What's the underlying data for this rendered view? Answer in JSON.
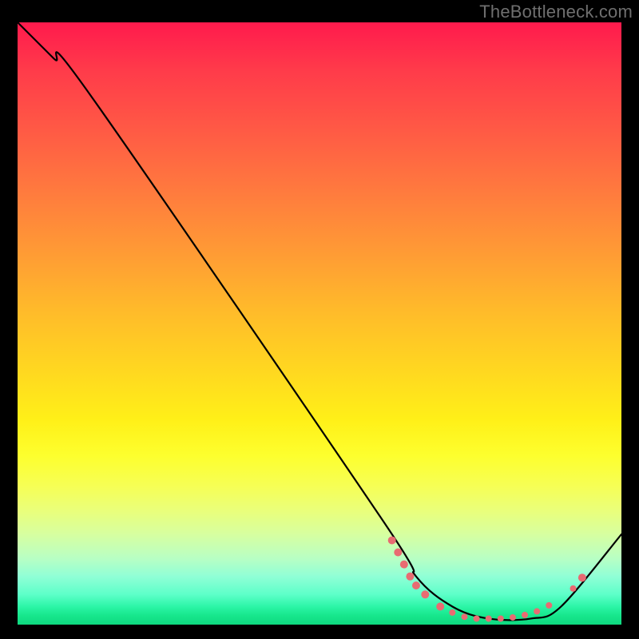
{
  "watermark": "TheBottleneck.com",
  "chart_data": {
    "type": "line",
    "title": "",
    "xlabel": "",
    "ylabel": "",
    "xlim": [
      0,
      100
    ],
    "ylim": [
      0,
      100
    ],
    "series": [
      {
        "name": "curve",
        "points": [
          {
            "x": 0,
            "y": 100
          },
          {
            "x": 6,
            "y": 94
          },
          {
            "x": 12,
            "y": 88
          },
          {
            "x": 60,
            "y": 18
          },
          {
            "x": 66,
            "y": 8
          },
          {
            "x": 72,
            "y": 3
          },
          {
            "x": 78,
            "y": 1
          },
          {
            "x": 85,
            "y": 1
          },
          {
            "x": 90,
            "y": 3
          },
          {
            "x": 100,
            "y": 15
          }
        ]
      }
    ],
    "markers": [
      {
        "x": 62,
        "y": 14,
        "r": 5
      },
      {
        "x": 63,
        "y": 12,
        "r": 5
      },
      {
        "x": 64,
        "y": 10,
        "r": 5
      },
      {
        "x": 65,
        "y": 8,
        "r": 5
      },
      {
        "x": 66,
        "y": 6.5,
        "r": 5
      },
      {
        "x": 67.5,
        "y": 5,
        "r": 5
      },
      {
        "x": 70,
        "y": 3,
        "r": 5
      },
      {
        "x": 72,
        "y": 2,
        "r": 4
      },
      {
        "x": 74,
        "y": 1.3,
        "r": 4
      },
      {
        "x": 76,
        "y": 1,
        "r": 4
      },
      {
        "x": 78,
        "y": 1,
        "r": 4
      },
      {
        "x": 80,
        "y": 1,
        "r": 4
      },
      {
        "x": 82,
        "y": 1.2,
        "r": 4
      },
      {
        "x": 84,
        "y": 1.6,
        "r": 4
      },
      {
        "x": 86,
        "y": 2.2,
        "r": 4
      },
      {
        "x": 88,
        "y": 3.2,
        "r": 4
      },
      {
        "x": 92,
        "y": 6,
        "r": 4
      },
      {
        "x": 93.5,
        "y": 7.8,
        "r": 5
      }
    ],
    "marker_color": "#e86b72",
    "curve_color": "#000000"
  }
}
